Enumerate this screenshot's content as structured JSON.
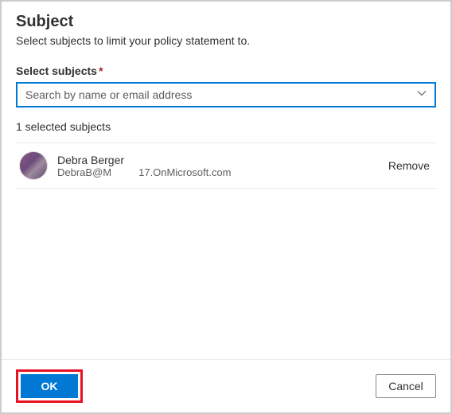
{
  "header": {
    "title": "Subject",
    "subtitle": "Select subjects to limit your policy statement to."
  },
  "field": {
    "label": "Select subjects",
    "required_mark": "*",
    "placeholder": "Search by name or email address"
  },
  "selection": {
    "count_text": "1 selected subjects"
  },
  "subjects": [
    {
      "name": "Debra Berger",
      "email_part1": "DebraB@M",
      "email_part2": "17.OnMicrosoft.com",
      "remove_label": "Remove"
    }
  ],
  "footer": {
    "ok_label": "OK",
    "cancel_label": "Cancel"
  }
}
